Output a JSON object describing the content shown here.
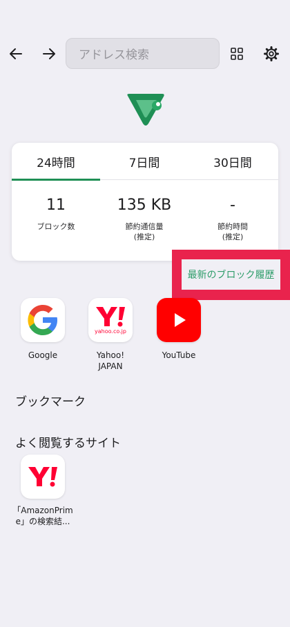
{
  "toolbar": {
    "back_icon": "arrow-left-icon",
    "forward_icon": "arrow-right-icon",
    "address_placeholder": "アドレス検索",
    "tabs_icon": "grid-icon",
    "settings_icon": "gear-icon"
  },
  "colors": {
    "accent": "#1f8f55",
    "link": "#2e9d6a",
    "highlight": "#e9234d",
    "background": "#f0eff5"
  },
  "stats": {
    "tabs": [
      {
        "label": "24時間",
        "selected": true
      },
      {
        "label": "7日間",
        "selected": false
      },
      {
        "label": "30日間",
        "selected": false
      }
    ],
    "items": [
      {
        "value": "11",
        "label": "ブロック数",
        "sub": ""
      },
      {
        "value": "135 KB",
        "label": "節約通信量",
        "sub": "(推定)"
      },
      {
        "value": "-",
        "label": "節約時間",
        "sub": "(推定)"
      }
    ]
  },
  "history_link": "最新のブロック履歴",
  "shortcuts": [
    {
      "label_line1": "Google",
      "label_line2": "",
      "icon": "google-icon"
    },
    {
      "label_line1": "Yahoo!",
      "label_line2": "JAPAN",
      "icon": "yahoo-icon",
      "icon_caption": "yahoo.co.jp"
    },
    {
      "label_line1": "YouTube",
      "label_line2": "",
      "icon": "youtube-icon"
    }
  ],
  "sections": {
    "bookmarks": "ブックマーク",
    "frequent": "よく閲覧するサイト"
  },
  "frequent_sites": [
    {
      "label_line1": "「AmazonPrim",
      "label_line2": "e」の検索結...",
      "icon": "yahoo-icon"
    }
  ]
}
